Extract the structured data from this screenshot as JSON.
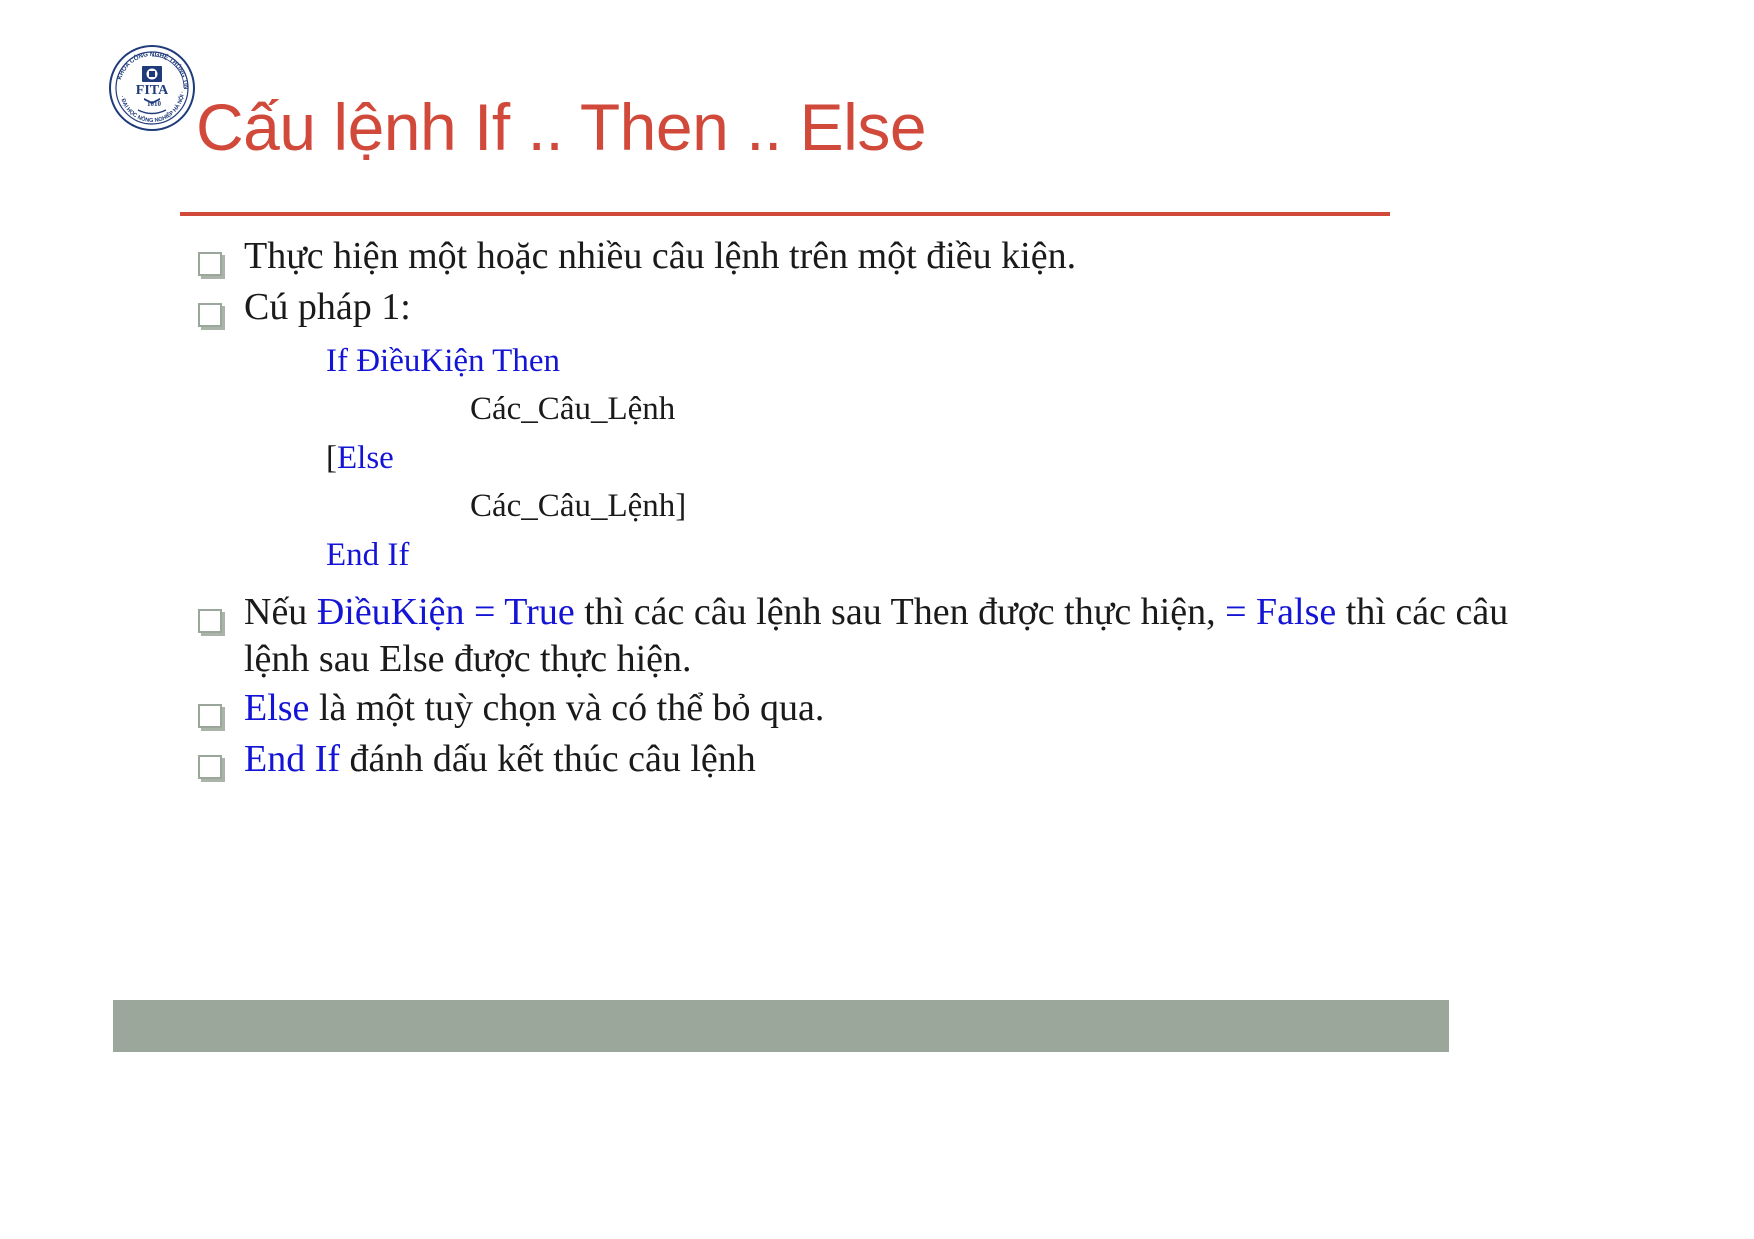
{
  "slide": {
    "title": "Cấu lệnh If .. Then .. Else",
    "accent_color": "#D1493A",
    "code_color": "#1414D6",
    "body_color": "#1a1a1a",
    "footer_color": "#9aa79a",
    "logo": {
      "acronym": "FITA",
      "year": "1010",
      "ring_top_text": "KHOA CÔNG NGHỆ THÔNG TIN",
      "ring_bottom_text": "ĐẠI HỌC NÔNG NGHIỆP HÀ NỘI"
    }
  },
  "bullets": [
    {
      "text": "Thực hiện một hoặc nhiều câu lệnh trên một điều kiện."
    },
    {
      "text": "Cú pháp 1:"
    }
  ],
  "code": {
    "line1": "If ĐiềuKiện Then",
    "line2": "Các_Câu_Lệnh",
    "line3_bracket": "[",
    "line3_keyword": "Else",
    "line4": "Các_Câu_Lệnh]",
    "line5": "End If"
  },
  "notes": {
    "note1": {
      "part1": "Nếu ",
      "part2": "ĐiềuKiện = True",
      "part3": " thì các câu lệnh sau Then được thực hiện, ",
      "part4": "= False",
      "part5": " thì các câu lệnh sau Else được thực hiện."
    },
    "note2": {
      "keyword": "Else",
      "rest": " là một tuỳ chọn và có thể bỏ qua."
    },
    "note3": {
      "keyword": "End If",
      "rest": " đánh dấu kết thúc câu lệnh"
    }
  }
}
